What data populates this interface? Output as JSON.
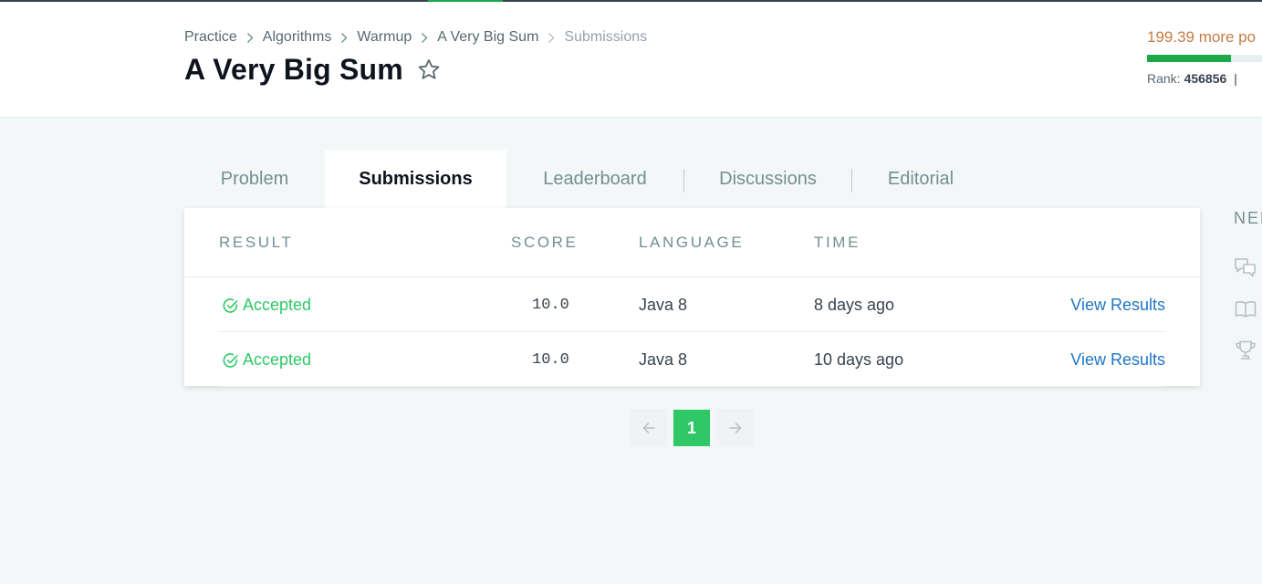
{
  "breadcrumb": {
    "items": [
      "Practice",
      "Algorithms",
      "Warmup",
      "A Very Big Sum",
      "Submissions"
    ]
  },
  "page_title": "A Very Big Sum",
  "points": {
    "text": "199.39 more po",
    "progress_fraction": 0.73,
    "rank_label": "Rank:",
    "rank_value": "456856",
    "rank_separator": "|"
  },
  "tabs": [
    {
      "label": "Problem",
      "active": false
    },
    {
      "label": "Submissions",
      "active": true
    },
    {
      "label": "Leaderboard",
      "active": false
    },
    {
      "label": "Discussions",
      "active": false
    },
    {
      "label": "Editorial",
      "active": false
    }
  ],
  "table": {
    "headers": {
      "result": "RESULT",
      "score": "SCORE",
      "language": "LANGUAGE",
      "time": "TIME"
    },
    "rows": [
      {
        "result": "Accepted",
        "score": "10.0",
        "language": "Java 8",
        "time": "8 days ago",
        "action": "View Results"
      },
      {
        "result": "Accepted",
        "score": "10.0",
        "language": "Java 8",
        "time": "10 days ago",
        "action": "View Results"
      }
    ]
  },
  "pagination": {
    "current_page": "1"
  },
  "side_panel": {
    "title": "NEE"
  },
  "colors": {
    "accent_green": "#1ba94c",
    "accepted_green": "#2ec866",
    "link_blue": "#1f75c4",
    "points_orange": "#c57c44"
  },
  "icons": [
    "chevron-right-icon",
    "star-outline-icon",
    "check-circle-icon",
    "arrow-left-icon",
    "arrow-right-icon",
    "discussion-icon",
    "book-icon",
    "trophy-icon"
  ]
}
